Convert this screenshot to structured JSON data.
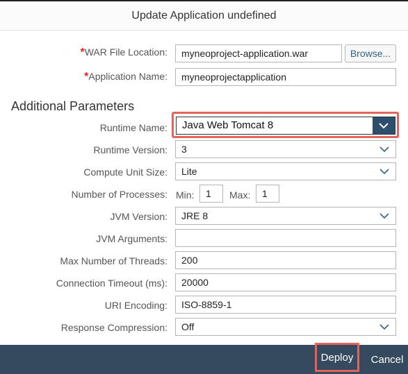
{
  "dialog": {
    "title": "Update Application undefined"
  },
  "form": {
    "required_mark": "*",
    "war_label": "WAR File Location:",
    "war_value": "myneoproject-application.war",
    "browse_label": "Browse...",
    "app_name_label": "Application Name:",
    "app_name_value": "myneoprojectapplication"
  },
  "additional": {
    "section_title": "Additional Parameters",
    "runtime_name_label": "Runtime Name:",
    "runtime_name_value": "Java Web Tomcat 8",
    "runtime_version_label": "Runtime Version:",
    "runtime_version_value": "3",
    "compute_unit_label": "Compute Unit Size:",
    "compute_unit_value": "Lite",
    "processes_label": "Number of Processes:",
    "min_label": "Min:",
    "min_value": "1",
    "max_label": "Max:",
    "max_value": "1",
    "jvm_version_label": "JVM Version:",
    "jvm_version_value": "JRE 8",
    "jvm_args_label": "JVM Arguments:",
    "jvm_args_value": "",
    "max_threads_label": "Max Number of Threads:",
    "max_threads_value": "200",
    "conn_timeout_label": "Connection Timeout (ms):",
    "conn_timeout_value": "20000",
    "uri_encoding_label": "URI Encoding:",
    "uri_encoding_value": "ISO-8859-1",
    "response_comp_label": "Response Compression:",
    "response_comp_value": "Off"
  },
  "footer": {
    "deploy_label": "Deploy",
    "cancel_label": "Cancel"
  },
  "colors": {
    "footer_bg": "#354a5f",
    "highlight": "#e2645a",
    "dropdown_accent": "#2e4e6e",
    "required": "#ee2222"
  },
  "icons": {
    "dropdown": "chevron-down-icon"
  }
}
